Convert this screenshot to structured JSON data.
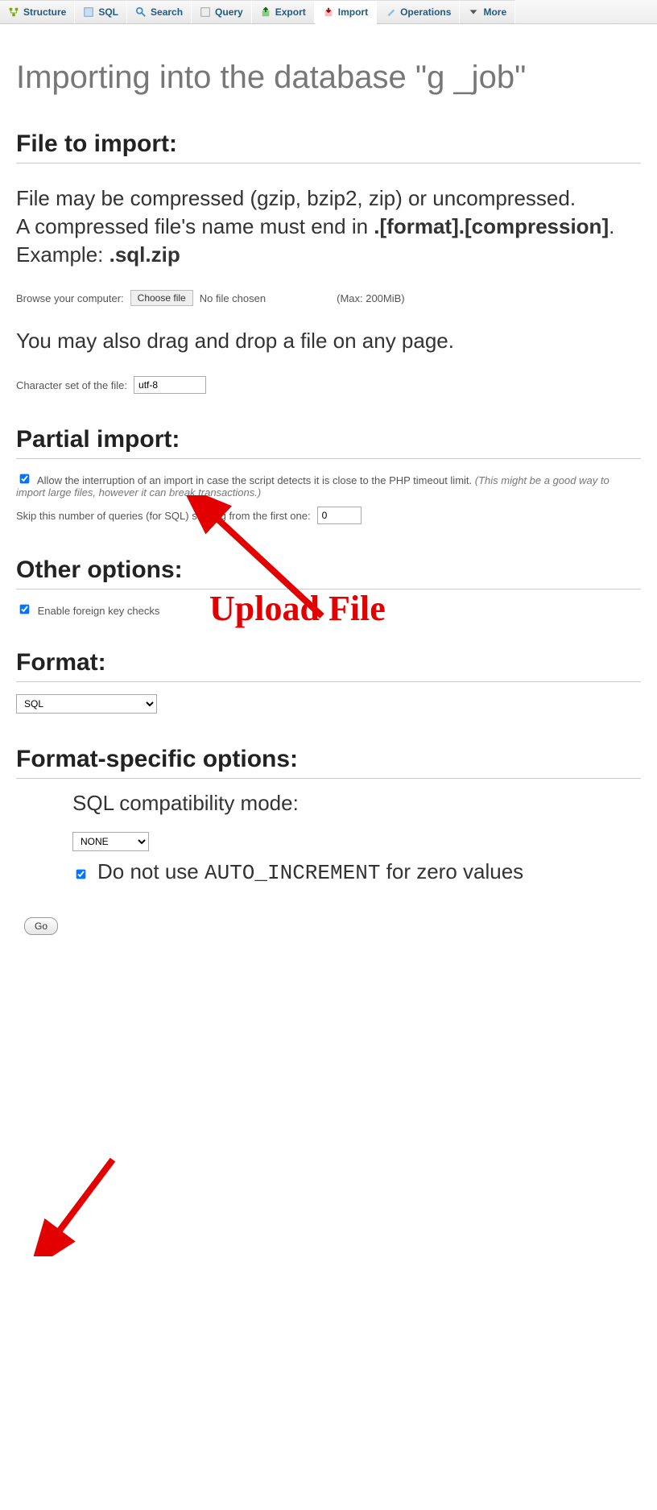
{
  "nav": {
    "structure": "Structure",
    "sql": "SQL",
    "search": "Search",
    "query": "Query",
    "export": "Export",
    "import": "Import",
    "operations": "Operations",
    "more": "More"
  },
  "title": "Importing into the database \"g                       _job\"",
  "file_section": {
    "heading": "File to import:",
    "desc_line1": "File may be compressed (gzip, bzip2, zip) or uncompressed.",
    "desc_line2a": "A compressed file's name must end in ",
    "desc_line2b": ".[format].[compression]",
    "desc_line2c": ". Example: ",
    "desc_line2d": ".sql.zip",
    "browse_label": "Browse your computer:",
    "choose_btn": "Choose file",
    "no_file": "No file chosen",
    "max_note": "(Max: 200MiB)",
    "dragdrop": "You may also drag and drop a file on any page.",
    "charset_label": "Character set of the file:",
    "charset_value": "utf-8"
  },
  "partial": {
    "heading": "Partial import:",
    "allow_label": "Allow the interruption of an import in case the script detects it is close to the PHP timeout limit. ",
    "allow_note": "(This might be a good way to import large files, however it can break transactions.)",
    "skip_label": "Skip this number of queries (for SQL) starting from the first one:",
    "skip_value": "0"
  },
  "other": {
    "heading": "Other options:",
    "fk_label": "Enable foreign key checks"
  },
  "format": {
    "heading": "Format:",
    "value": "SQL"
  },
  "specific": {
    "heading": "Format-specific options:",
    "compat_label": "SQL compatibility mode:",
    "compat_value": "NONE",
    "noauto_a": "Do not use ",
    "noauto_mono": "AUTO_INCREMENT",
    "noauto_b": " for zero values"
  },
  "go_btn": "Go",
  "annotation": {
    "upload_text": "Upload File"
  }
}
